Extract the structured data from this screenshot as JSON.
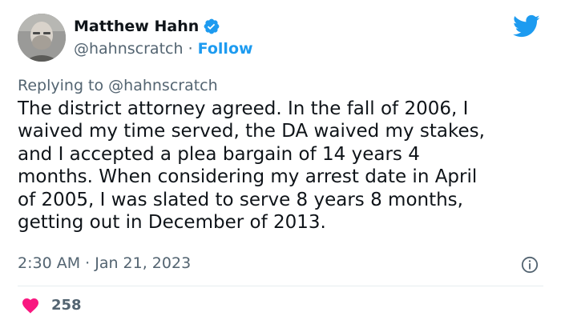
{
  "author": {
    "name": "Matthew Hahn",
    "handle": "@hahnscratch",
    "separator": "·",
    "follow_label": "Follow"
  },
  "reply": {
    "text": "Replying to @hahnscratch"
  },
  "tweet": {
    "lines": [
      "The district attorney agreed. In the fall of 2006, I",
      "waived my time served, the DA waived my stakes,",
      "and I accepted a plea bargain of 14 years 4",
      "months. When considering my arrest date in April",
      "of 2005, I was slated to serve 8 years 8 months,",
      "getting out in December of 2013."
    ],
    "timestamp": "2:30 AM · Jan 21, 2023"
  },
  "engagement": {
    "likes": "258"
  },
  "icons": {
    "verified": "verified-badge-icon",
    "brand": "twitter-bird-icon",
    "info": "info-icon",
    "like": "heart-icon"
  },
  "colors": {
    "accent": "#1d9bf0",
    "like": "#f91880",
    "secondary_text": "#536471",
    "primary_text": "#0f1419"
  }
}
